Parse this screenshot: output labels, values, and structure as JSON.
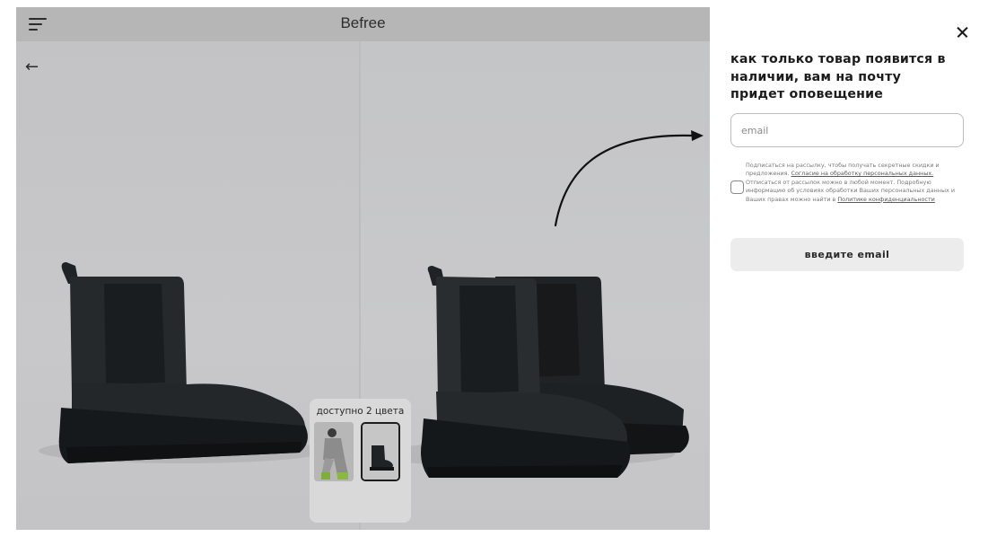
{
  "store": {
    "brand": "Befree",
    "back_arrow": "←",
    "colors_label": "доступно 2 цвета"
  },
  "panel": {
    "close_icon": "×",
    "notify_text": "как только товар появится в наличии, вам на почту придет оповещение",
    "email_placeholder": "email",
    "consent": {
      "part1": "Подписаться на рассылку, чтобы получать секретные скидки и предложения. ",
      "link1": "Согласие на обработку персональных данных.",
      "part2": " Отписаться от рассылок можно в любой момент. Подробную информацию об условиях обработки Ваших персональных данных и Ваших правах можно найти в ",
      "link2": "Политике конфиденциальности"
    },
    "submit_label": "введите email"
  },
  "colors": {
    "overlay": "#c9c9c9",
    "boot": "#1f2326",
    "button_bg": "#ececec",
    "annotation_arrow": "#111111"
  }
}
